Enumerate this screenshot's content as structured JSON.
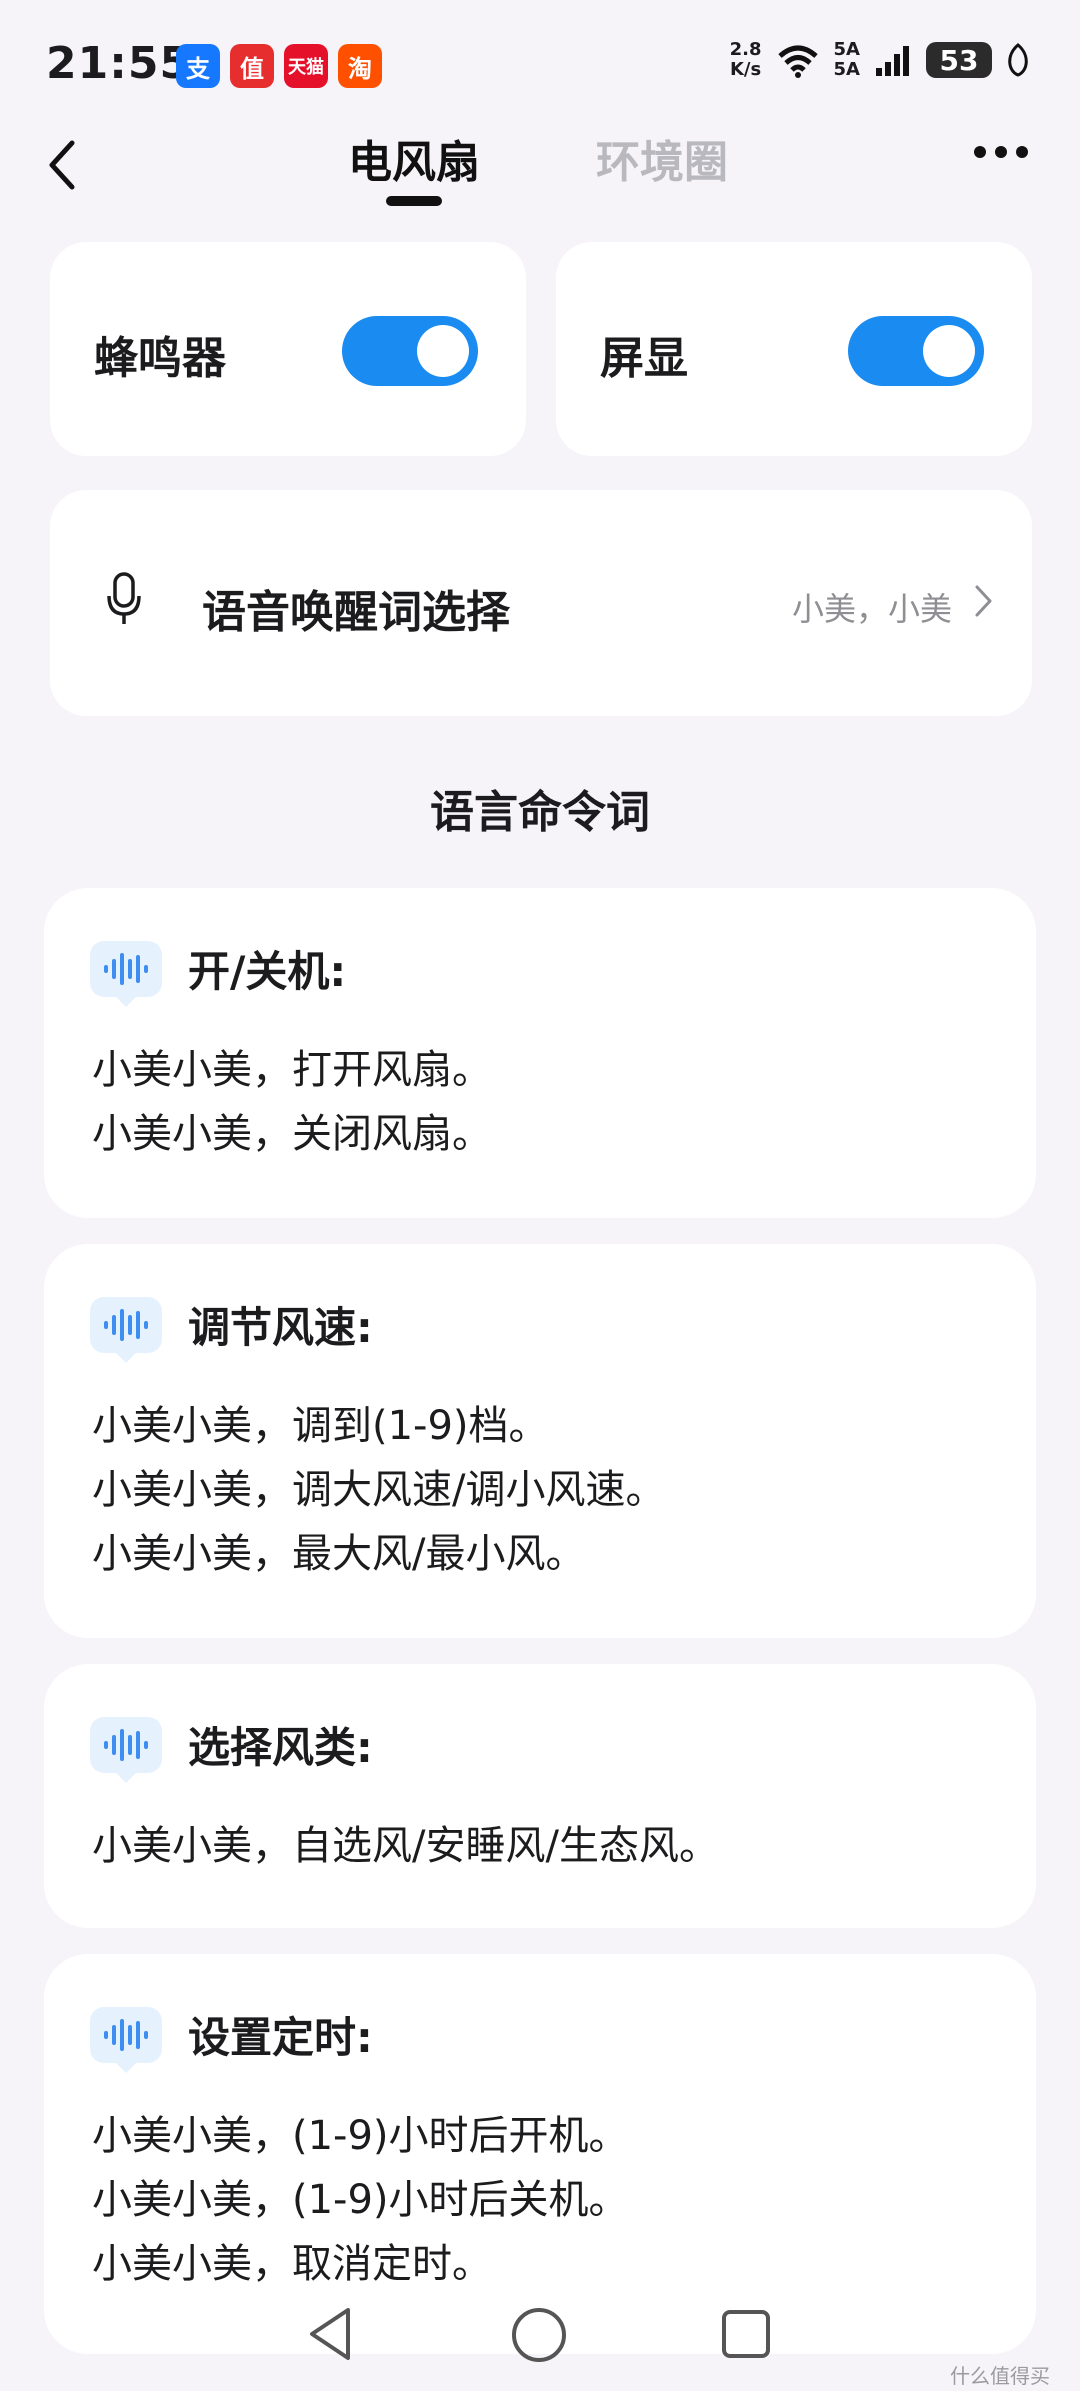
{
  "status_bar": {
    "time": "21:55",
    "app_icons": [
      {
        "name": "alipay-icon",
        "label": "支",
        "color": "#1677ff"
      },
      {
        "name": "smzdm-icon",
        "label": "值",
        "color": "#e62e2e"
      },
      {
        "name": "tmall-icon",
        "label": "天猫",
        "color": "#e5102a"
      },
      {
        "name": "taobao-icon",
        "label": "淘",
        "color": "#ff5000"
      }
    ],
    "net_speed_value": "2.8",
    "net_speed_unit": "K/s",
    "sim_top": "5A",
    "sim_bottom": "5A",
    "battery": "53"
  },
  "navbar": {
    "tabs": [
      {
        "label": "电风扇",
        "active": true
      },
      {
        "label": "环境圈",
        "active": false
      }
    ]
  },
  "toggles": [
    {
      "label": "蜂鸣器",
      "on": true
    },
    {
      "label": "屏显",
      "on": true
    }
  ],
  "wake_word": {
    "title": "语音唤醒词选择",
    "value": "小美，小美"
  },
  "section_title": "语言命令词",
  "commands": [
    {
      "title": "开/关机:",
      "lines": [
        "小美小美，打开风扇。",
        "小美小美，关闭风扇。"
      ]
    },
    {
      "title": "调节风速:",
      "lines": [
        "小美小美，调到(1-9)档。",
        "小美小美，调大风速/调小风速。",
        "小美小美，最大风/最小风。"
      ]
    },
    {
      "title": "选择风类:",
      "lines": [
        "小美小美，自选风/安睡风/生态风。"
      ]
    },
    {
      "title": "设置定时:",
      "lines": [
        "小美小美，(1-9)小时后开机。",
        "小美小美，(1-9)小时后关机。",
        "小美小美，取消定时。"
      ]
    }
  ],
  "watermark": "什么值得买",
  "colors": {
    "accent": "#1a8bf0",
    "background": "#f6f4f9",
    "voice_icon_bg": "#e6f1fe"
  }
}
